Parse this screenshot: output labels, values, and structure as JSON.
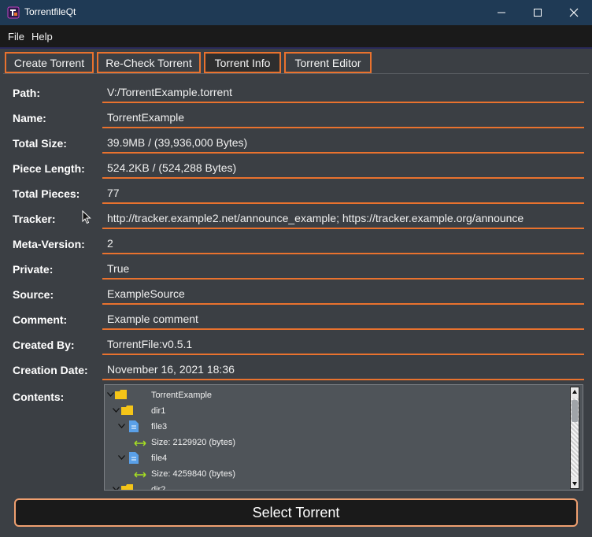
{
  "window": {
    "title": "TorrentfileQt"
  },
  "menu": {
    "items": [
      "File",
      "Help"
    ]
  },
  "tabs": [
    {
      "label": "Create Torrent",
      "active": false
    },
    {
      "label": "Re-Check Torrent",
      "active": false
    },
    {
      "label": "Torrent Info",
      "active": true
    },
    {
      "label": "Torrent Editor",
      "active": false
    }
  ],
  "info": {
    "fields": [
      {
        "label": "Path:",
        "value": "V:/TorrentExample.torrent"
      },
      {
        "label": "Name:",
        "value": "TorrentExample"
      },
      {
        "label": "Total Size:",
        "value": "39.9MB / (39,936,000 Bytes)"
      },
      {
        "label": "Piece Length:",
        "value": "524.2KB / (524,288 Bytes)"
      },
      {
        "label": "Total Pieces:",
        "value": "77"
      },
      {
        "label": "Tracker:",
        "value": "http://tracker.example2.net/announce_example; https://tracker.example.org/announce"
      },
      {
        "label": "Meta-Version:",
        "value": "2"
      },
      {
        "label": "Private:",
        "value": "True"
      },
      {
        "label": "Source:",
        "value": "ExampleSource"
      },
      {
        "label": "Comment:",
        "value": "Example comment"
      },
      {
        "label": "Created By:",
        "value": "TorrentFile:v0.5.1"
      },
      {
        "label": "Creation Date:",
        "value": "November 16, 2021 18:36"
      }
    ],
    "contents_label": "Contents:"
  },
  "tree": {
    "nodes": [
      {
        "text": "TorrentExample",
        "kind": "folder",
        "expanded": true
      },
      {
        "text": "dir1",
        "kind": "folder",
        "expanded": true
      },
      {
        "text": "file3",
        "kind": "file",
        "expanded": true
      },
      {
        "text": "Size: 2129920 (bytes)",
        "kind": "size"
      },
      {
        "text": "file4",
        "kind": "file",
        "expanded": true
      },
      {
        "text": "Size: 4259840 (bytes)",
        "kind": "size"
      },
      {
        "text": "dir2",
        "kind": "folder",
        "expanded": true
      }
    ]
  },
  "actions": {
    "select_label": "Select Torrent"
  },
  "colors": {
    "accent": "#e9722e",
    "titlebar": "#1f3a55",
    "background": "#3b3f44"
  }
}
